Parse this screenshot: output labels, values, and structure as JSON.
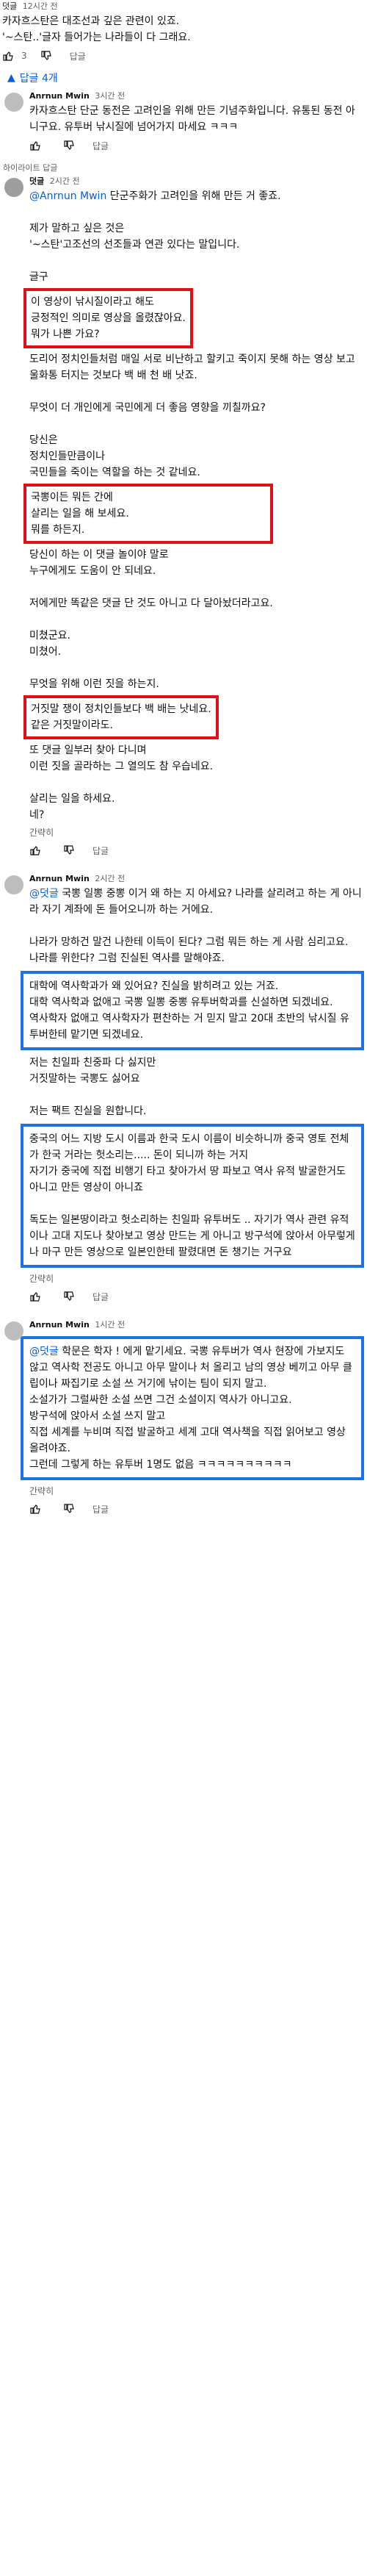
{
  "top_comment": {
    "author": "덧글",
    "time": "12시간 전",
    "text": "카자흐스탄은 대조선과 깊은 관련이 있죠.\n'~스탄..'글자 들어가는 나라들이 다 그래요.",
    "likes": "3",
    "reply_label": "답글"
  },
  "replies_toggle": "답글 4개",
  "reply_label": "답글",
  "more_label": "간략히",
  "replies": [
    {
      "author": "Anrnun Mwin",
      "time": "3시간 전",
      "text": "카자흐스탄 단군 동전은 고려인을 위해 만든 기념주화입니다. 유통된 동전 아니구요. 유투버 낚시질에 넘어가지 마세요 ㅋㅋㅋ"
    },
    {
      "pinned_label": "하이라이트 답글",
      "author": "덧글",
      "time": "2시간 전",
      "mention": "@Anrnun Mwin",
      "intro": "단군주화가 고려인을 위해 만든 거 좋죠.\n\n제가 말하고 싶은 것은\n'~스탄'고조선의 선조들과 연관 있다는 말입니다.\n\n글구",
      "box1": "이 영상이 낚시질이라고 해도\n긍정적인 의미로 영상을 올렸잖아요.\n뭐가 나쁜 가요?",
      "mid1": "도리어 정치인들처럼 매일 서로 비난하고 할키고 죽이지 못해 하는 영상 보고 울화통 터지는 것보다 백 배 천 배 낫죠.\n\n무엇이 더 개인에게 국민에게 더 좋음 영향을 끼칠까요?\n\n당신은\n정치인들만큼이나\n국민들을 죽이는 역할을 하는 것 같네요.",
      "box2": "국뽕이든 뭐든 간에\n살리는 일을 해 보세요.\n뭐를 하든지.",
      "mid2": "당신이 하는 이 댓글 놀이야 말로\n누구에게도 도움이 안 되네요.\n\n저에게만 똑같은 댓글 단 것도 아니고 다 달아놨더라고요.\n\n미쳤군요.\n미쳤어.\n\n무엇을 위해 이런 짓을 하는지.",
      "box3": "거짓말 쟁이 정치인들보다 백 배는 낫네요.\n같은 거짓말이라도.",
      "outro": "또 댓글 일부러 찾아 다니며\n이런 짓을 골라하는 그 열의도 참 우습네요.\n\n살리는 일을 하세요.\n네?"
    },
    {
      "author": "Anrnun Mwin",
      "time": "2시간 전",
      "mention": "@덧글",
      "intro": "국뽕 일뽕 중뽕 이거 왜 하는 지 아세요? 나라를 살리려고 하는 게 아니라 자기 계좌에 돈 들어오니까 하는 거에요.\n\n나라가 망하건 말건 나한테 이득이 된다? 그럼 뭐든 하는 게 사람 심리고요.\n나라를 위한다? 그럼 진실된 역사를 말해야죠.",
      "box1": "대학에 역사학과가 왜 있어요? 진실을 밝히려고 있는 거죠.\n대학 역사학과 없애고 국뽕 일뽕 중뽕 유투버학과를 신설하면 되겠네요.\n역사학자 없애고 역사학자가 편찬하는 거 믿지 말고 20대 초반의 낚시질 유투버한테 맡기면 되겠네요.",
      "mid1": "저는 친일파 친중파 다 싫지만\n거짓말하는 국뽕도 싫어요\n\n저는 팩트 진실을 원합니다.",
      "box2": "중국의 어느 지방 도시 이름과 한국 도시 이름이 비슷하니까 중국 영토 전체가 한국 거라는 헛소리는..... 돈이 되니까 하는 거지\n자기가 중국에 직접 비행기 타고 찾아가서 땅 파보고 역사 유적 발굴한거도 아니고 만든 영상이 아니죠\n\n독도는 일본땅이라고 헛소리하는 친일파 유투버도 .. 자기가 역사 관련 유적이나 고대 지도나 찾아보고 영상 만드는 게 아니고 방구석에 앉아서 아무렇게나 마구 만든 영상으로 일본인한테 팔렸대면 돈 챙기는 거구요"
    },
    {
      "author": "Anrnun Mwin",
      "time": "1시간 전",
      "mention": "@덧글",
      "box1": "학문은 학자 ! 에게 맡기세요. 국뽕 유투버가 역사 현장에 가보지도 않고 역사학 전공도 아니고 아무 말이나 처 올리고 남의 영상 베끼고 아무 클립이나 짜집기로 소설 쓰 거기에 낚이는 팀이 되지 말고.\n소설가가 그럴싸한 소설 쓰면 그건 소설이지 역사가 아니고요.\n방구석에 앉아서 소설 쓰지 말고\n직접 세계를 누비며 직접 발굴하고 세계 고대 역사책을 직접 읽어보고 영상 올려야죠.\n그런데 그렇게 하는 유투버 1명도 없음 ㅋㅋㅋㅋㅋㅋㅋㅋㅋㅋ"
    }
  ]
}
